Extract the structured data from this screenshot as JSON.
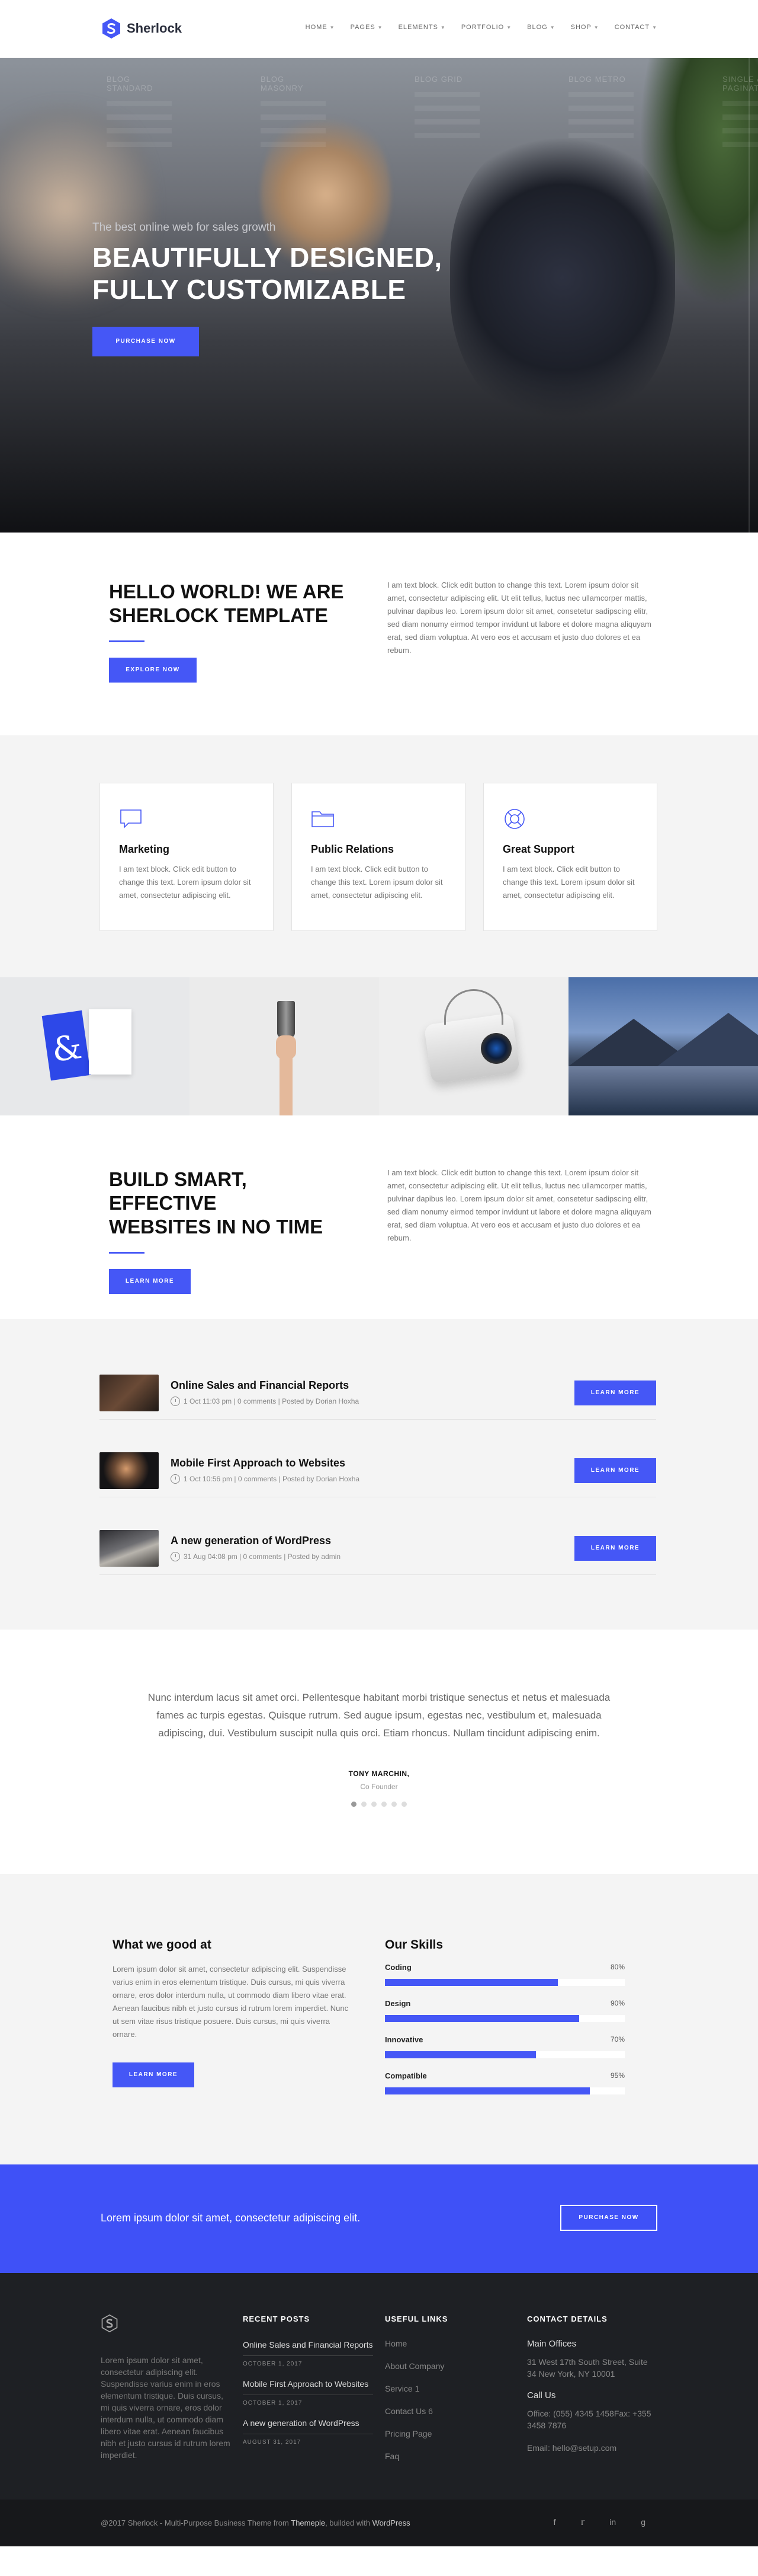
{
  "header": {
    "logo_text": "Sherlock",
    "nav": [
      "HOME",
      "PAGES",
      "ELEMENTS",
      "PORTFOLIO",
      "BLOG",
      "SHOP",
      "CONTACT"
    ]
  },
  "hero": {
    "menu_overlay": [
      "BLOG STANDARD",
      "BLOG MASONRY",
      "BLOG GRID",
      "BLOG METRO",
      "SINGLE & PAGINATION"
    ],
    "subtitle": "The best online web for sales growth",
    "title_line1": "BEAUTIFULLY DESIGNED,",
    "title_line2": "FULLY CUSTOMIZABLE",
    "button": "PURCHASE NOW"
  },
  "intro": {
    "title_line1": "HELLO WORLD! WE ARE",
    "title_line2": "SHERLOCK TEMPLATE",
    "button": "EXPLORE NOW",
    "text": "I am text block. Click edit button to change this text. Lorem ipsum dolor sit amet, consectetur adipiscing elit. Ut elit tellus, luctus nec ullamcorper mattis, pulvinar dapibus leo. Lorem ipsum dolor sit amet, consetetur sadipscing elitr, sed diam nonumy eirmod tempor invidunt ut labore et dolore magna aliquyam erat, sed diam voluptua. At vero eos et accusam et justo duo dolores et ea rebum."
  },
  "services": [
    {
      "title": "Marketing",
      "icon": "chat-bubble-icon",
      "text": "I am text block. Click edit button to change this text. Lorem ipsum dolor sit amet, consectetur adipiscing elit."
    },
    {
      "title": "Public Relations",
      "icon": "folder-icon",
      "text": "I am text block. Click edit button to change this text. Lorem ipsum dolor sit amet, consectetur adipiscing elit."
    },
    {
      "title": "Great Support",
      "icon": "lifebuoy-icon",
      "text": "I am text block. Click edit button to change this text. Lorem ipsum dolor sit amet, consectetur adipiscing elit."
    }
  ],
  "build": {
    "title_line1": "BUILD SMART, EFFECTIVE",
    "title_line2": "WEBSITES IN NO TIME",
    "button": "LEARN MORE",
    "text": "I am text block. Click edit button to change this text. Lorem ipsum dolor sit amet, consectetur adipiscing elit. Ut elit tellus, luctus nec ullamcorper mattis, pulvinar dapibus leo. Lorem ipsum dolor sit amet, consetetur sadipscing elitr, sed diam nonumy eirmod tempor invidunt ut labore et dolore magna aliquyam erat, sed diam voluptua. At vero eos et accusam et justo duo dolores et ea rebum."
  },
  "posts": [
    {
      "title": "Online Sales and Financial Reports",
      "meta": "1 Oct 11:03 pm  |  0 comments  |  Posted by Dorian Hoxha",
      "button": "LEARN MORE"
    },
    {
      "title": "Mobile First Approach to Websites",
      "meta": "1 Oct 10:56 pm  |  0 comments  |  Posted by Dorian Hoxha",
      "button": "LEARN MORE"
    },
    {
      "title": "A new generation of WordPress",
      "meta": "31 Aug 04:08 pm  |  0 comments  |  Posted by admin",
      "button": "LEARN MORE"
    }
  ],
  "testimonial": {
    "quote": "Nunc interdum lacus sit amet orci. Pellentesque habitant morbi tristique senectus et netus et malesuada fames ac turpis egestas. Quisque rutrum. Sed augue ipsum, egestas nec, vestibulum et, malesuada adipiscing, dui. Vestibulum suscipit nulla quis orci. Etiam rhoncus. Nullam tincidunt adipiscing enim.",
    "name": "TONY MARCHIN,",
    "role": "Co Founder"
  },
  "skills": {
    "left_title": "What we good at",
    "left_text": "Lorem ipsum dolor sit amet, consectetur adipiscing elit. Suspendisse varius enim in eros elementum tristique. Duis cursus, mi quis viverra ornare, eros dolor interdum nulla, ut commodo diam libero vitae erat. Aenean faucibus nibh et justo cursus id rutrum lorem imperdiet. Nunc ut sem vitae risus tristique posuere. Duis cursus, mi quis viverra ornare.",
    "button": "LEARN MORE",
    "right_title": "Our Skills",
    "items": [
      {
        "name": "Coding",
        "value": 80,
        "label": "80%"
      },
      {
        "name": "Design",
        "value": 90,
        "label": "90%"
      },
      {
        "name": "Innovative",
        "value": 70,
        "label": "70%"
      },
      {
        "name": "Compatible",
        "value": 95,
        "label": "95%"
      }
    ]
  },
  "cta": {
    "text": "Lorem ipsum dolor sit amet, consectetur adipiscing elit.",
    "button": "PURCHASE NOW"
  },
  "footer": {
    "about": "Lorem ipsum dolor sit amet, consectetur adipiscing elit. Suspendisse varius enim in eros elementum tristique. Duis cursus, mi quis viverra ornare, eros dolor interdum nulla, ut commodo diam libero vitae erat. Aenean faucibus nibh et justo cursus id rutrum lorem imperdiet.",
    "recent_posts_title": "RECENT POSTS",
    "recent_posts": [
      {
        "title": "Online Sales and Financial Reports",
        "date": "OCTOBER 1, 2017"
      },
      {
        "title": "Mobile First Approach to Websites",
        "date": "OCTOBER 1, 2017"
      },
      {
        "title": "A new generation of WordPress",
        "date": "AUGUST 31, 2017"
      }
    ],
    "links_title": "USEFUL LINKS",
    "links": [
      "Home",
      "About Company",
      "Service 1",
      "Contact Us 6",
      "Pricing Page",
      "Faq"
    ],
    "contact_title": "CONTACT DETAILS",
    "main_offices_title": "Main Offices",
    "main_offices_text": "31 West 17th South Street, Suite 34 New York, NY 10001",
    "call_us_title": "Call Us",
    "call_us_text": "Office: (055) 4345 1458Fax: +355 3458 7876",
    "email": "Email: hello@setup.com"
  },
  "bottom": {
    "copyright_prefix": "@2017 Sherlock - Multi-Purpose Business Theme from ",
    "copyright_brand": "Themeple",
    "copyright_mid": ", builded with ",
    "copyright_wp": "WordPress",
    "socials": [
      "facebook-icon",
      "twitter-icon",
      "linkedin-icon",
      "google-plus-icon"
    ]
  },
  "colors": {
    "accent": "#4557f6",
    "cta_bg": "#3f51f7",
    "footer_bg": "#1e2024"
  }
}
